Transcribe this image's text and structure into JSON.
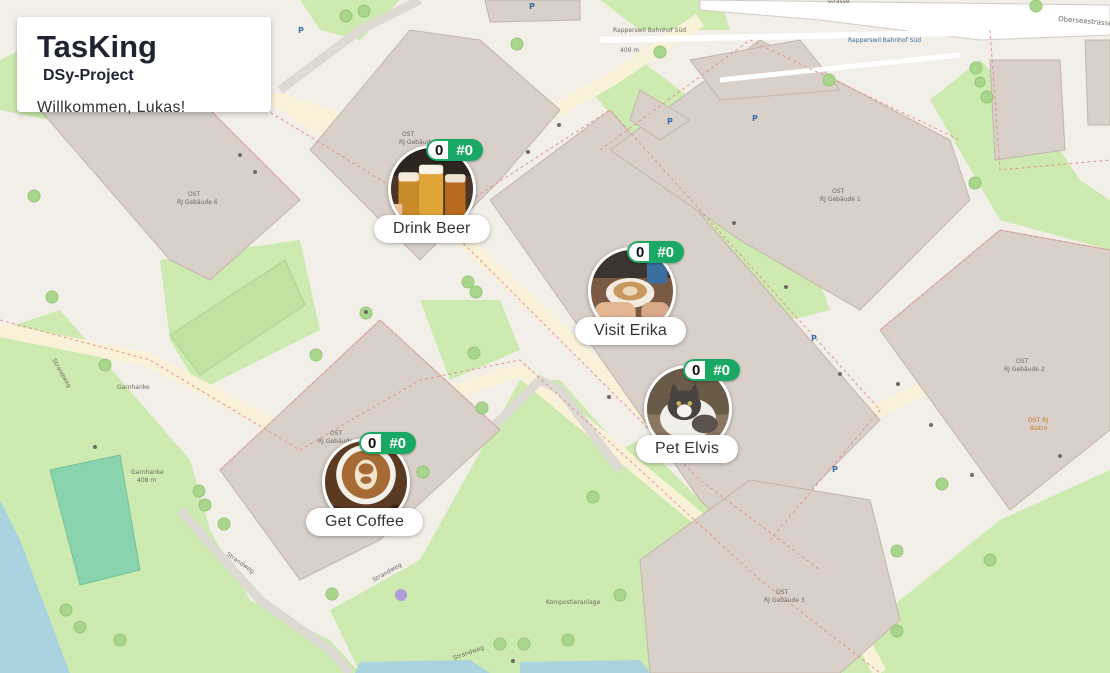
{
  "app": {
    "title": "TasKing",
    "subtitle": "DSy-Project",
    "welcome": "Willkommen, Lukas!"
  },
  "tasks": [
    {
      "name": "Drink Beer",
      "count": "0",
      "rank": "#0",
      "image": "beer-photo"
    },
    {
      "name": "Visit Erika",
      "count": "0",
      "rank": "#0",
      "image": "coffee-cup-photo"
    },
    {
      "name": "Pet Elvis",
      "count": "0",
      "rank": "#0",
      "image": "cat-photo"
    },
    {
      "name": "Get Coffee",
      "count": "0",
      "rank": "#0",
      "image": "latte-art-photo"
    }
  ],
  "map_labels": {
    "ost_short": "OST",
    "gebaeude6": "RJ Gebäude 6",
    "gebaeude1": "RJ Gebäude 1",
    "gebaeude2": "RJ Gebäude 2",
    "gebaeude4": "RJ Gebäude 4",
    "gebaeude3": "RJ Gebäude 3",
    "gebaeude_top": "RJ Gebäude",
    "garnhanke": "Garnhanke",
    "garnhanke_peak": "Garnhanke",
    "garnhanke_ele": "408 m",
    "strandweg": "Strandweg",
    "rapperswil_sued": "Rapperswil Bahnhof Süd",
    "rapperswil_sued_ele": "409 m",
    "rapperswil_sued2": "Rapperswil Bahnhof Süd",
    "kompostieranlage": "Kompostieranlage",
    "oberseestrasse": "Oberseestrasse",
    "strasse": "strasse",
    "ost_rj": "OST RJ",
    "ost_rj_bistro": "Bistro"
  },
  "colors": {
    "accent": "#1aa865",
    "building": "#d9d0c9",
    "park": "#cdebb0",
    "water": "#aad3df",
    "path": "#faf1d9",
    "boundary": "#e8928e"
  }
}
